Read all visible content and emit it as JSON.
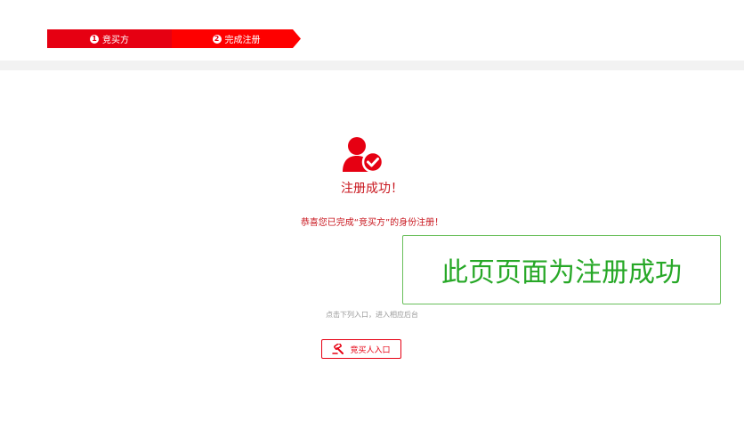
{
  "steps": [
    {
      "num": "1",
      "label": "竞买方"
    },
    {
      "num": "2",
      "label": "完成注册"
    }
  ],
  "result": {
    "icon": "user-check-icon",
    "title": "注册成功！",
    "message": "恭喜您已完成“竞买方”的身份注册！"
  },
  "entry": {
    "hint": "点击下列入口，进入相应后台",
    "button_label": "竞买人入口",
    "button_icon": "gavel-icon"
  },
  "annotation": {
    "text": "此页页面为注册成功"
  },
  "colors": {
    "brand": "#e60012",
    "annotation": "#27a827"
  }
}
